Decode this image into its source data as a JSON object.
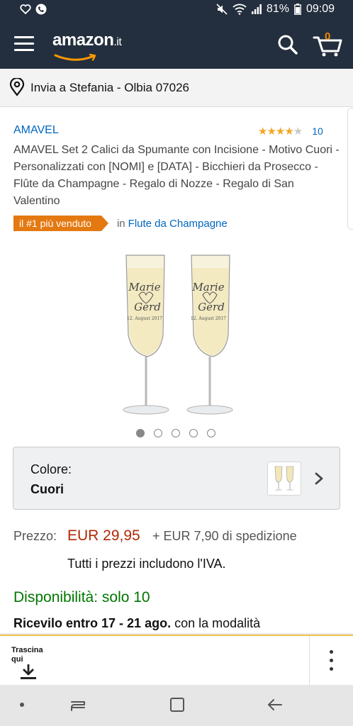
{
  "status_bar": {
    "battery": "81%",
    "time": "09:09",
    "icons": [
      "heart-icon",
      "phone-icon",
      "mute-icon",
      "wifi-icon",
      "signal-icon",
      "battery-icon"
    ]
  },
  "header": {
    "logo": "amazon",
    "logo_tld": ".it",
    "cart_count": "0",
    "icons": [
      "menu-icon",
      "search-icon",
      "cart-icon"
    ],
    "colors": {
      "background": "#232f3e",
      "cart_count": "#f08804"
    }
  },
  "delivery": {
    "text": "Invia a Stefania - Olbia 07026",
    "icon": "location-pin-icon"
  },
  "product": {
    "brand": "AMAVEL",
    "rating_stars": 4,
    "rating_max": 5,
    "rating_count": "10",
    "title": "AMAVEL Set 2 Calici da Spumante con Incisione - Motivo Cuori - Personalizzati con [NOMI] e [DATA] - Bicchieri da Prosecco - Flûte da Champagne - Regalo di Nozze - Regalo di San Valentino",
    "badge": "il #1 più venduto",
    "badge_in": "in",
    "badge_category": "Flute da Champagne",
    "engraving": {
      "name1": "Marie",
      "name2": "Gerd",
      "date": "12. August 2017"
    },
    "image_count": 5,
    "image_active": 0,
    "colors": {
      "link": "#0066c0",
      "badge": "#e47911",
      "price": "#b12704",
      "availability": "#007600"
    }
  },
  "color_selector": {
    "label": "Colore:",
    "value": "Cuori"
  },
  "price": {
    "label": "Prezzo:",
    "value": "EUR 29,95",
    "shipping": "+ EUR 7,90 di spedizione",
    "vat_note": "Tutti i prezzi includono l'IVA."
  },
  "availability": {
    "text": "Disponibilità: solo 10",
    "delivery_bold": "Ricevilo entro 17 - 21 ago.",
    "delivery_rest": " con la modalità"
  },
  "drag_bar": {
    "label": "Trascina qui",
    "icons": [
      "download-icon",
      "more-vert-icon"
    ]
  },
  "nav_bar": {
    "icons": [
      "nav-dot-icon",
      "recent-apps-icon",
      "home-icon",
      "back-icon"
    ]
  }
}
